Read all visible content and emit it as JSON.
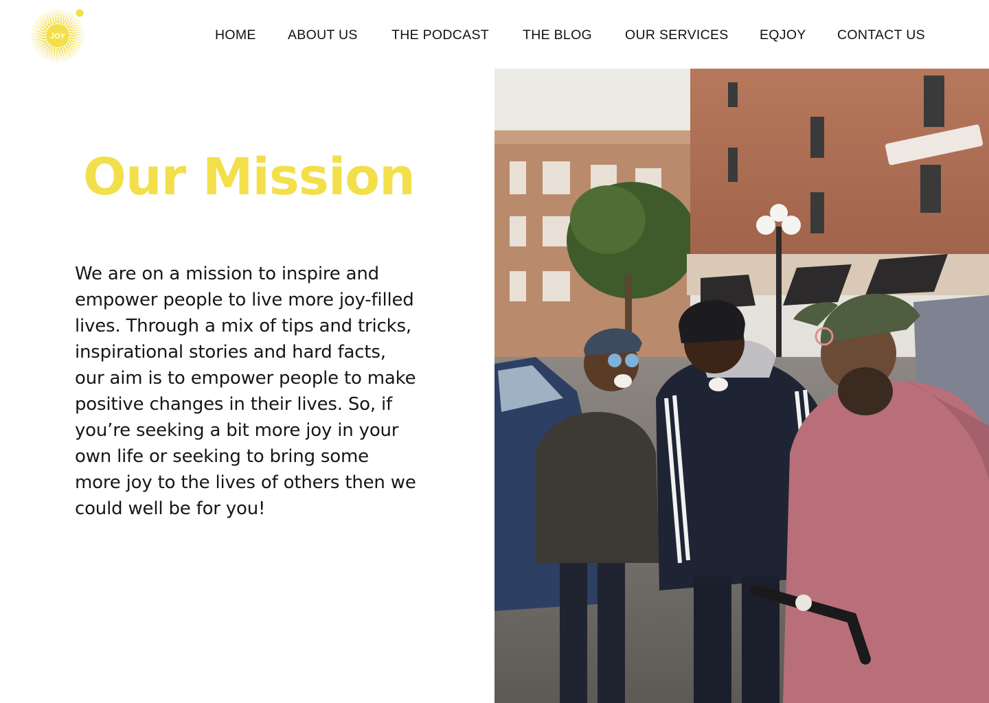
{
  "brand": {
    "logo_text": "JOY",
    "logo_icon": "sunburst-dot-logo",
    "accent_color": "#f2df4b"
  },
  "nav": {
    "items": [
      {
        "label": "HOME"
      },
      {
        "label": "ABOUT US"
      },
      {
        "label": "THE PODCAST"
      },
      {
        "label": "THE BLOG"
      },
      {
        "label": "OUR SERVICES"
      },
      {
        "label": "EQJOY"
      },
      {
        "label": "CONTACT US"
      }
    ]
  },
  "mission": {
    "title": "Our Mission",
    "body": "We are on a mission to inspire and empower people to live more joy-filled lives. Through a mix of tips and tricks, inspirational stories and hard facts, our aim is to empower people to make positive changes in their lives.  So, if you’re seeking a bit more joy in your own life or seeking to bring some more joy to the lives of others then we could well be for you!"
  },
  "hero_image": {
    "icon": "street-photo-three-friends-laughing"
  }
}
